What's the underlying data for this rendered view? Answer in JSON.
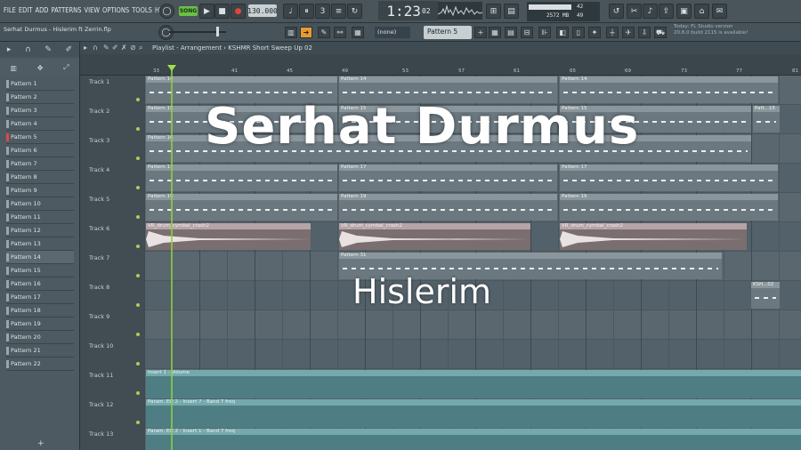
{
  "menu": [
    "FILE",
    "EDIT",
    "ADD",
    "PATTERNS",
    "VIEW",
    "OPTIONS",
    "TOOLS",
    "HELP"
  ],
  "transport": {
    "mode_label": "SONG",
    "tempo": "130.000",
    "time_main": "1:23",
    "time_sub": "02"
  },
  "monitor": {
    "cpu": "42",
    "ram": "2572 MB",
    "polyphony": "49"
  },
  "hint": "Serhat Durmus - Hislerim ft Zerrin.flp",
  "pattern_dropdown": "(none)",
  "pattern_selector": "Pattern 5",
  "update_note": {
    "line1": "Today: FL Studio version",
    "line2": "20.8.0 build 2115 is available!"
  },
  "playlist": {
    "title": "Playlist - Arrangement › KSHMR Short Sweep Up 02"
  },
  "ruler": [
    "33",
    "41",
    "45",
    "49",
    "53",
    "57",
    "61",
    "65",
    "69",
    "73",
    "77",
    "81"
  ],
  "patterns": [
    "Pattern 1",
    "Pattern 2",
    "Pattern 3",
    "Pattern 4",
    "Pattern 5",
    "Pattern 6",
    "Pattern 7",
    "Pattern 8",
    "Pattern 9",
    "Pattern 10",
    "Pattern 11",
    "Pattern 12",
    "Pattern 13",
    "Pattern 14",
    "Pattern 15",
    "Pattern 16",
    "Pattern 17",
    "Pattern 18",
    "Pattern 19",
    "Pattern 20",
    "Pattern 21",
    "Pattern 22"
  ],
  "tracks": [
    "Track 1",
    "Track 2",
    "Track 3",
    "Track 4",
    "Track 5",
    "Track 6",
    "Track 7",
    "Track 8",
    "Track 9",
    "Track 10",
    "Track 11",
    "Track 12",
    "Track 13"
  ],
  "clips": {
    "p14": "Pattern 14",
    "p15": "Pattern 15",
    "p15s": "Patt...15",
    "p16": "Pattern 16",
    "p17": "Pattern 17",
    "p19": "Pattern 19",
    "crash": "VR_drum_cymbal_crash2",
    "p31": "Pattern 31",
    "ksh": "KSH...02",
    "auto1": "Insert 1 - Volume",
    "auto2": "Param. EQ 2 - Insert 7 - Band 7 freq",
    "auto3": "Param. EQ 2 - Insert 1 - Band 7 freq"
  },
  "overlay": {
    "artist": "Serhat Durmus",
    "song": "Hislerim"
  },
  "colors": {
    "playhead": "#8fcf3c",
    "song_button": "#69c146"
  }
}
